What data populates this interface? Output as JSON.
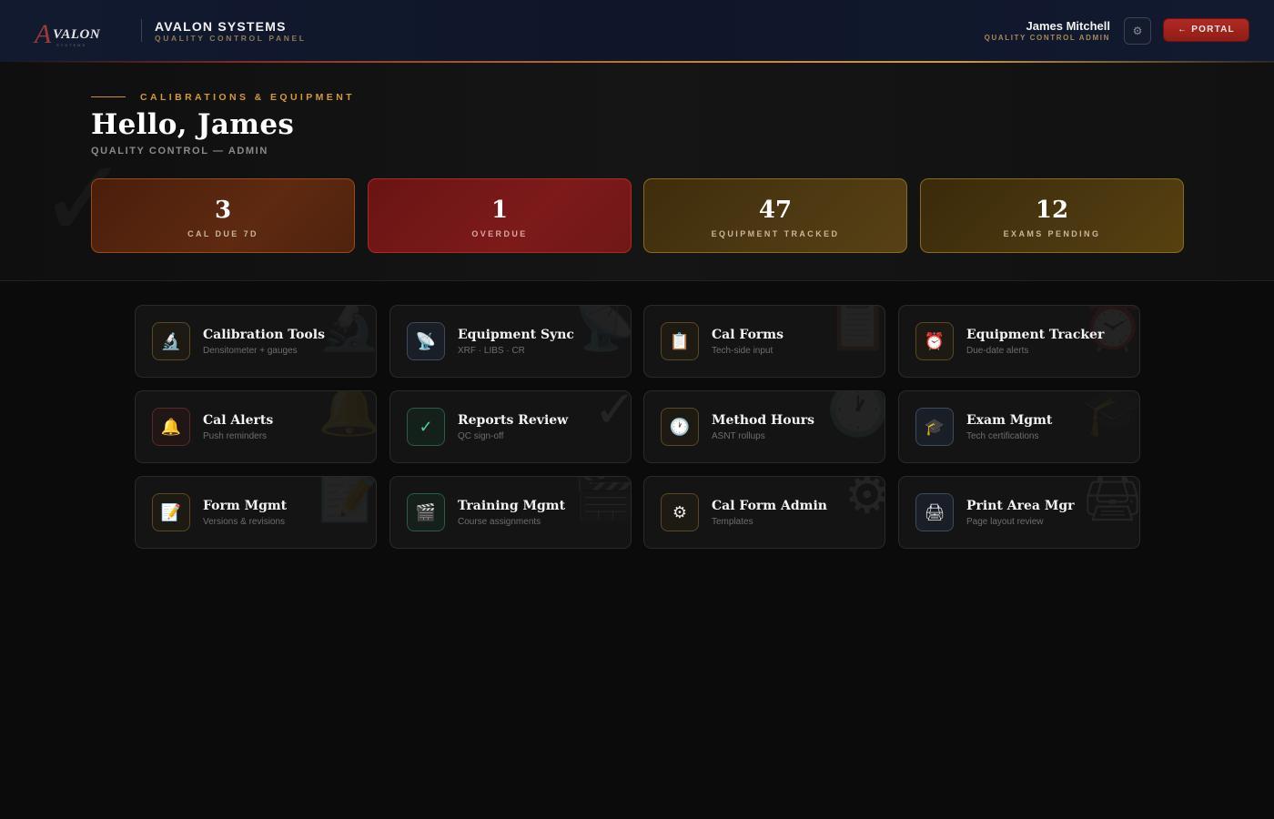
{
  "header": {
    "logo_text": "VALON",
    "logo_initial": "A",
    "logo_sub": "SYSTEMS",
    "brand_title": "AVALON SYSTEMS",
    "brand_subtitle": "QUALITY CONTROL PANEL",
    "user_name": "James Mitchell",
    "user_role": "QUALITY CONTROL ADMIN",
    "settings_icon": "gear-icon",
    "portal_button": "← PORTAL"
  },
  "hero": {
    "eyebrow": "CALIBRATIONS & EQUIPMENT",
    "greeting": "Hello, James",
    "subtitle": "QUALITY CONTROL — ADMIN",
    "stats": [
      {
        "value": "3",
        "label": "CAL DUE 7D"
      },
      {
        "value": "1",
        "label": "OVERDUE"
      },
      {
        "value": "47",
        "label": "EQUIPMENT TRACKED"
      },
      {
        "value": "12",
        "label": "EXAMS PENDING"
      }
    ]
  },
  "tiles": [
    {
      "title": "Calibration Tools",
      "subtitle": "Densitometer + gauges",
      "icon": "microscope-icon",
      "glyph": "🔬"
    },
    {
      "title": "Equipment Sync",
      "subtitle": "XRF · LIBS · CR",
      "icon": "satellite-dish-icon",
      "glyph": "📡"
    },
    {
      "title": "Cal Forms",
      "subtitle": "Tech-side input",
      "icon": "clipboard-icon",
      "glyph": "📋"
    },
    {
      "title": "Equipment Tracker",
      "subtitle": "Due-date alerts",
      "icon": "alarm-clock-icon",
      "glyph": "⏰"
    },
    {
      "title": "Cal Alerts",
      "subtitle": "Push reminders",
      "icon": "bell-icon",
      "glyph": "🔔"
    },
    {
      "title": "Reports Review",
      "subtitle": "QC sign-off",
      "icon": "checkmark-icon",
      "glyph": "✓"
    },
    {
      "title": "Method Hours",
      "subtitle": "ASNT rollups",
      "icon": "clock-icon",
      "glyph": "🕐"
    },
    {
      "title": "Exam Mgmt",
      "subtitle": "Tech certifications",
      "icon": "graduation-cap-icon",
      "glyph": "🎓"
    },
    {
      "title": "Form Mgmt",
      "subtitle": "Versions & revisions",
      "icon": "memo-icon",
      "glyph": "📝"
    },
    {
      "title": "Training Mgmt",
      "subtitle": "Course assignments",
      "icon": "clapperboard-icon",
      "glyph": "🎬"
    },
    {
      "title": "Cal Form Admin",
      "subtitle": "Templates",
      "icon": "gear-icon",
      "glyph": "⚙"
    },
    {
      "title": "Print Area Mgr",
      "subtitle": "Page layout review",
      "icon": "printer-icon",
      "glyph": "🖨"
    }
  ]
}
